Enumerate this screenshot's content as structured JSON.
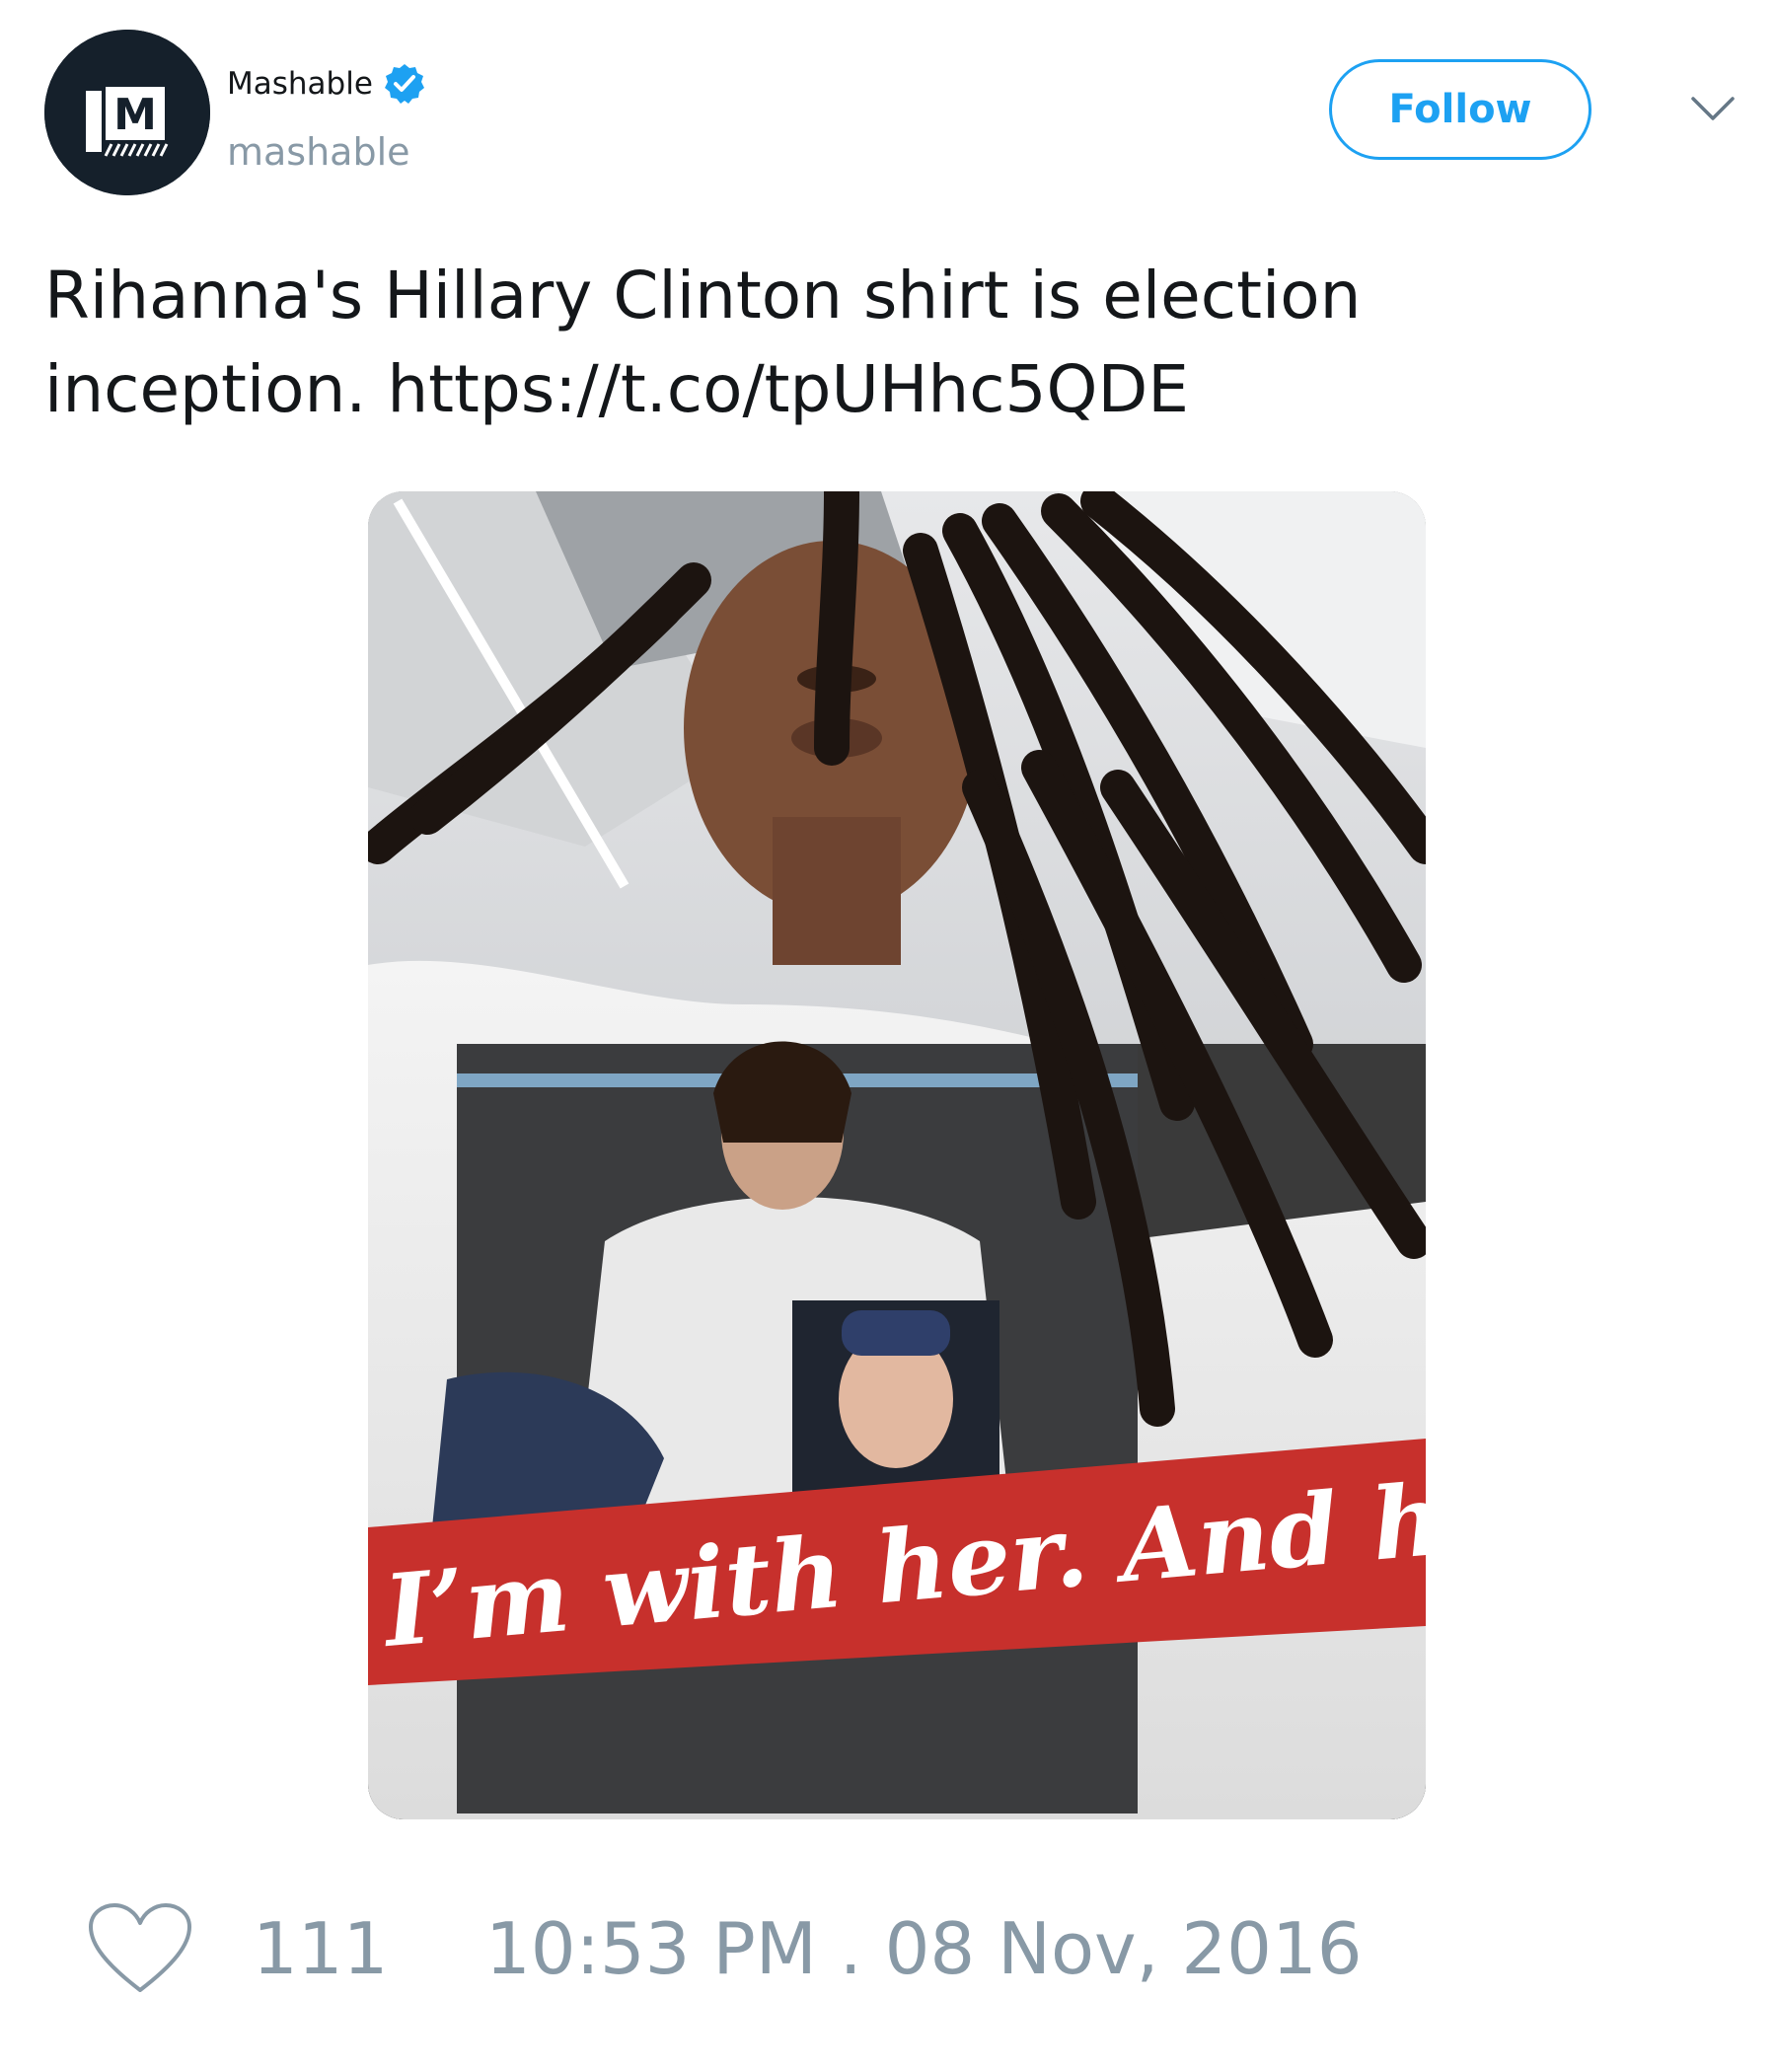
{
  "author": {
    "name": "Mashable",
    "handle": "mashable",
    "verified": true,
    "avatar_letter": "M",
    "avatar_icon": "mashable-logo-icon"
  },
  "follow_button": {
    "label": "Follow"
  },
  "menu": {
    "icon": "chevron-down-icon"
  },
  "tweet": {
    "text_line1": "Rihanna's Hillary Clinton shirt is election",
    "text_line2_prefix": "inception. ",
    "link": "https://t.co/tpUHhc5QDE"
  },
  "media": {
    "banner_text": "I’m with her. And he"
  },
  "footer": {
    "like_icon": "heart-icon",
    "like_count": "111",
    "timestamp": "10:53 PM . 08 Nov, 2016"
  },
  "colors": {
    "accent": "#1da1f2",
    "muted": "#8899a6",
    "text": "#14171a",
    "avatar_bg": "#15202b",
    "banner_red": "#c7302c"
  }
}
